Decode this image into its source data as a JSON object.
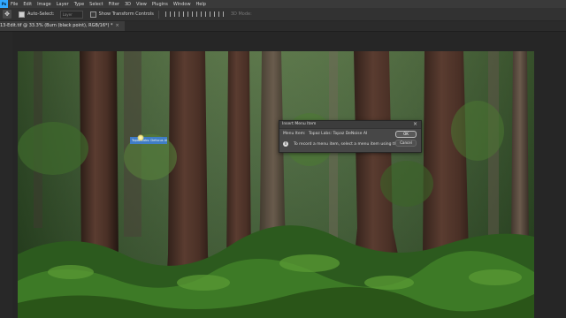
{
  "app": {
    "logo": "Ps"
  },
  "menubar": {
    "items": [
      "File",
      "Edit",
      "Image",
      "Layer",
      "Type",
      "Select",
      "Filter",
      "3D",
      "View",
      "Plugins",
      "Window",
      "Help"
    ]
  },
  "options": {
    "tool_icon": "move-tool-icon",
    "auto_select_label": "Auto-Select:",
    "auto_select_checked": true,
    "layer_dropdown": "Layer",
    "transform_label": "Show Transform Controls",
    "transform_checked": false,
    "mode_3d_label": "3D Mode:"
  },
  "document": {
    "tab_title": "13-Edit.tif @ 33.3% (Burn (black point), RGB/16*) *",
    "close_glyph": "×"
  },
  "overlay": {
    "hover_tag": "Topaz Labs: Defocus AI"
  },
  "dialog": {
    "title": "Insert Menu Item",
    "close_glyph": "×",
    "menu_item_label": "Menu Item:",
    "menu_item_value": "Topaz Labs: Topaz DeNoise AI",
    "message": "To record a menu item, select a menu item using the mouse.",
    "ok_label": "OK",
    "cancel_label": "Cancel"
  },
  "colors": {
    "accent": "#31a8ff",
    "tag_blue": "#3f7fd6",
    "dialog_bg": "#474747",
    "chrome": "#323232"
  }
}
